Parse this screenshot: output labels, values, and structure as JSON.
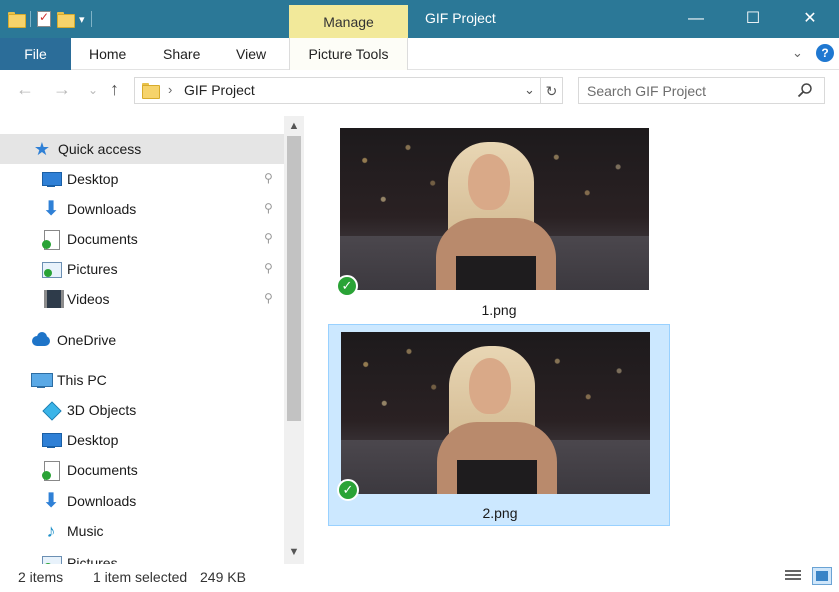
{
  "window": {
    "title": "GIF Project",
    "contextual_tab": "Manage",
    "minimize_glyph": "—",
    "maximize_glyph": "☐",
    "close_glyph": "✕"
  },
  "ribbon": {
    "tabs": [
      "File",
      "Home",
      "Share",
      "View"
    ],
    "contextual_label": "Picture Tools",
    "expand_glyph": "⌄",
    "help_glyph": "?"
  },
  "address": {
    "path": "GIF Project",
    "separator": "›",
    "dropdown_glyph": "⌄",
    "refresh_glyph": "↻",
    "back_glyph": "←",
    "forward_glyph": "→",
    "history_glyph": "⌄",
    "up_glyph": "↑"
  },
  "search": {
    "placeholder": "Search GIF Project",
    "value": ""
  },
  "navpane": {
    "quick_access": "Quick access",
    "quick_items": [
      {
        "label": "Desktop",
        "icon": "desktop-icon"
      },
      {
        "label": "Downloads",
        "icon": "downloads-icon"
      },
      {
        "label": "Documents",
        "icon": "documents-icon"
      },
      {
        "label": "Pictures",
        "icon": "pictures-icon"
      },
      {
        "label": "Videos",
        "icon": "videos-icon"
      }
    ],
    "onedrive": "OneDrive",
    "this_pc": "This PC",
    "pc_items": [
      {
        "label": "3D Objects",
        "icon": "3d-objects-icon"
      },
      {
        "label": "Desktop",
        "icon": "desktop-icon"
      },
      {
        "label": "Documents",
        "icon": "documents-icon"
      },
      {
        "label": "Downloads",
        "icon": "downloads-icon"
      },
      {
        "label": "Music",
        "icon": "music-icon"
      },
      {
        "label": "Pictures",
        "icon": "pictures-icon"
      }
    ],
    "pin_glyph": "📌",
    "scroll_up_glyph": "▲",
    "scroll_down_glyph": "▼"
  },
  "files": [
    {
      "name": "1.png",
      "selected": false,
      "sync_status": "available"
    },
    {
      "name": "2.png",
      "selected": true,
      "sync_status": "available"
    }
  ],
  "status": {
    "items": "2 items",
    "selection": "1 item selected",
    "size": "249 KB"
  },
  "colors": {
    "titlebar": "#2b7897",
    "manage_tab": "#f2e99a",
    "file_tab": "#2b6d99",
    "selection": "#cce8ff",
    "sync_check": "#2aa336"
  }
}
